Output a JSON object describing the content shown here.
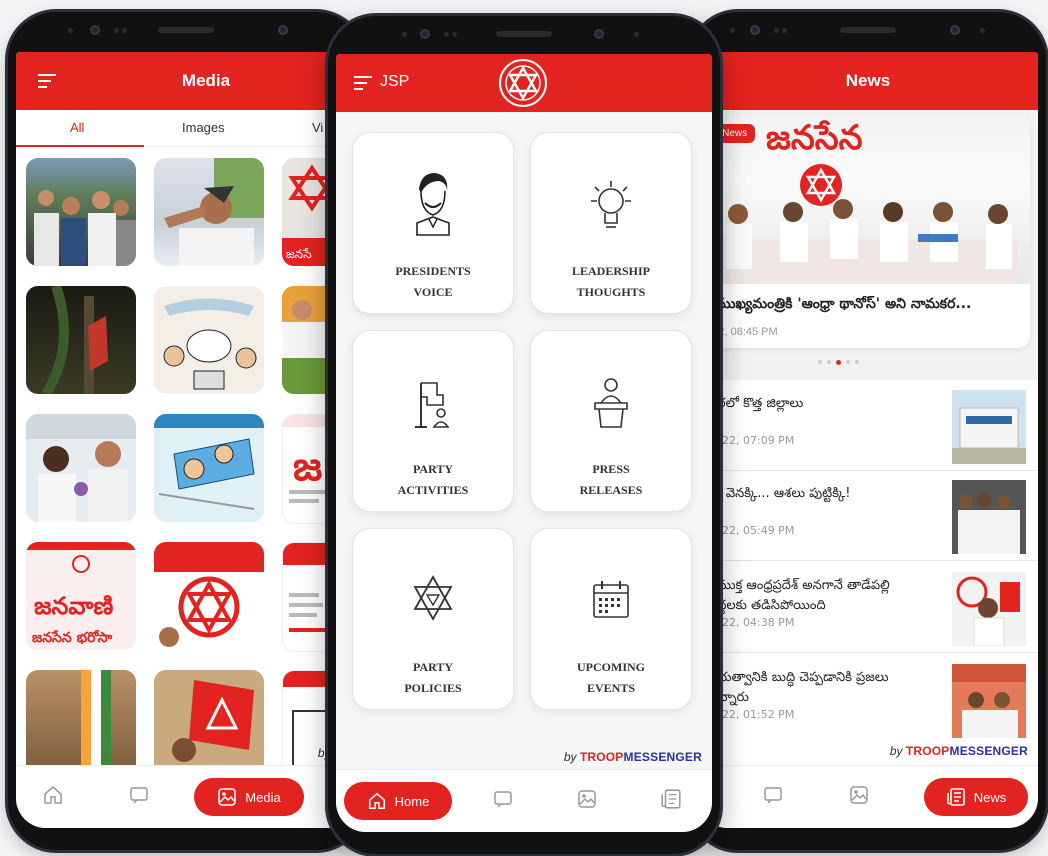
{
  "colors": {
    "brand_red": "#e3231f",
    "brand_blue": "#2b2f9a",
    "bg": "#f4f4f6"
  },
  "footer_by": "by",
  "footer_brand_red": "TROOP",
  "footer_brand_blue": "MESSENGER",
  "footer_brand_partial": "TROOPME",
  "media": {
    "title": "Media",
    "tabs": [
      "All",
      "Images",
      "Vi"
    ],
    "active_tab": "All",
    "nav": {
      "active_label": "Media",
      "icons": [
        "home-icon",
        "chat-icon",
        "image-icon"
      ]
    }
  },
  "home": {
    "title": "JSP",
    "cards": [
      {
        "line1": "PRESIDENTS",
        "line2": "VOICE",
        "icon": "leader-portrait-icon"
      },
      {
        "line1": "LEADERSHIP",
        "line2": "THOUGHTS",
        "icon": "lightbulb-icon"
      },
      {
        "line1": "PARTY",
        "line2": "ACTIVITIES",
        "icon": "flag-person-icon"
      },
      {
        "line1": "PRESS",
        "line2": "RELEASES",
        "icon": "podium-icon"
      },
      {
        "line1": "PARTY",
        "line2": "POLICIES",
        "icon": "star-emblem-icon"
      },
      {
        "line1": "UPCOMING",
        "line2": "EVENTS",
        "icon": "calendar-icon"
      }
    ],
    "nav": {
      "active_label": "Home",
      "icons": [
        "chat-icon",
        "image-icon",
        "newspaper-icon"
      ]
    }
  },
  "news": {
    "title": "News",
    "banner_badge": "ing News",
    "banner_logo_text": "జనసేన",
    "headline": "ు ముఖ్యమంత్రికి 'ఆంధ్రా థానోస్' అని నామకర...",
    "headline_date": "2022, 08:45 PM",
    "items": [
      {
        "headline": "చెరలో కొత్త జిల్లాలు",
        "date": "2022, 07:09 PM"
      },
      {
        "headline": "లు వెనక్కి... ఆశలు పుట్టిక్కి!",
        "date": "2022, 05:49 PM"
      },
      {
        "headline": "విముక్త ఆంధ్రప్రదేశ్ అనగానే తాడేపల్లి\nపెద్దలకు తడిసిపోయింది",
        "date": "2022, 04:38 PM"
      },
      {
        "headline": "ప్రభుత్వానికి బుద్ధి చెప్పడానికి ప్రజలు\nఉన్నారు",
        "date": "2022, 01:52 PM"
      }
    ],
    "nav": {
      "active_label": "News",
      "icons": [
        "chat-icon",
        "image-icon"
      ]
    }
  },
  "media_tiles": [
    {
      "caption": ""
    },
    {
      "caption": "జనసే"
    },
    {
      "caption": "జనసేన భరోసా"
    }
  ]
}
